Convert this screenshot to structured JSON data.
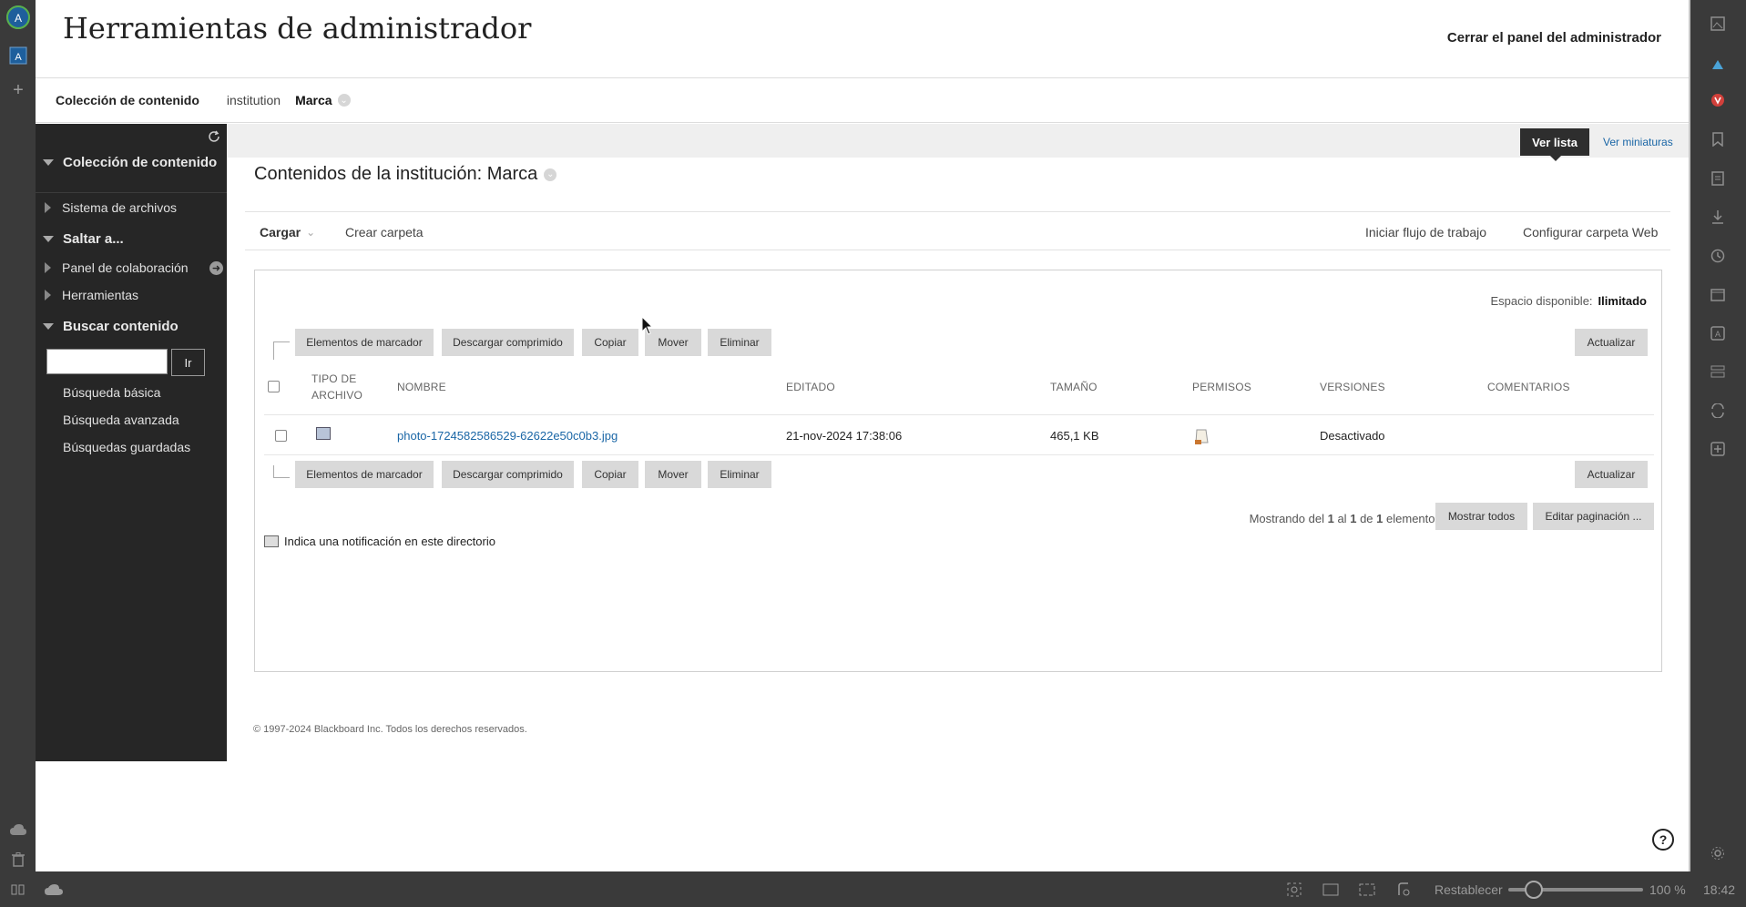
{
  "admin": {
    "title": "Herramientas de administrador",
    "close_label": "Cerrar el panel del administrador"
  },
  "breadcrumb": {
    "root": "Colección de contenido",
    "level1": "institution",
    "current": "Marca"
  },
  "sidebar": {
    "section_collection": "Colección de contenido",
    "file_system": "Sistema de archivos",
    "section_jump": "Saltar a...",
    "collab_panel": "Panel de colaboración",
    "tools": "Herramientas",
    "section_search": "Buscar contenido",
    "search_button": "Ir",
    "search_value": "",
    "basic_search": "Búsqueda básica",
    "advanced_search": "Búsqueda avanzada",
    "saved_searches": "Búsquedas guardadas"
  },
  "view": {
    "list_label": "Ver lista",
    "thumbs_label": "Ver miniaturas"
  },
  "content": {
    "title": "Contenidos de la institución: Marca"
  },
  "actions": {
    "upload": "Cargar",
    "create_folder": "Crear carpeta",
    "start_workflow": "Iniciar flujo de trabajo",
    "webfolder": "Configurar carpeta Web"
  },
  "panel": {
    "space_label": "Espacio disponible:",
    "space_value": "Ilimitado",
    "buttons": {
      "bookmark": "Elementos de marcador",
      "download_zip": "Descargar comprimido",
      "copy": "Copiar",
      "move": "Mover",
      "delete": "Eliminar",
      "refresh": "Actualizar"
    },
    "columns": {
      "file_type_1": "TIPO DE",
      "file_type_2": "ARCHIVO",
      "name": "NOMBRE",
      "edited": "EDITADO",
      "size": "TAMAÑO",
      "permissions": "PERMISOS",
      "versions": "VERSIONES",
      "comments": "COMENTARIOS"
    },
    "rows": [
      {
        "name": "photo-1724582586529-62622e50c0b3.jpg",
        "edited": "21-nov-2024 17:38:06",
        "size": "465,1 KB",
        "versions": "Desactivado"
      }
    ],
    "pager": {
      "prefix": "Mostrando del",
      "from": "1",
      "mid1": "al",
      "to": "1",
      "mid2": "de",
      "total": "1",
      "suffix": "elementos"
    },
    "show_all": "Mostrar todos",
    "edit_paging": "Editar paginación ...",
    "legend": "Indica una notificación en este directorio"
  },
  "footer": {
    "copyright": "© 1997-2024 Blackboard Inc. Todos los derechos reservados."
  },
  "statusbar": {
    "reset": "Restablecer",
    "zoom": "100 %",
    "time": "18:42"
  },
  "colors": {
    "accent": "#1a66a6",
    "sidebar_bg": "#262626",
    "browser_chrome": "#3a3a3a"
  }
}
